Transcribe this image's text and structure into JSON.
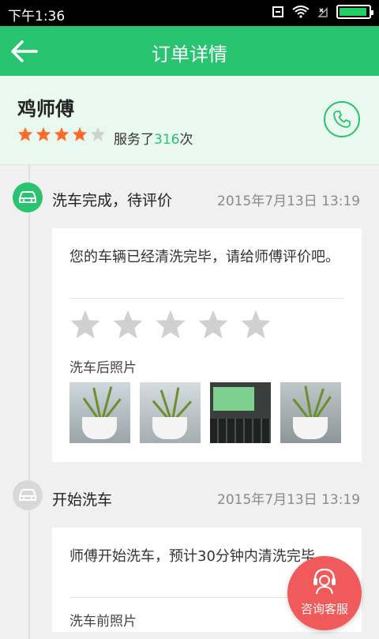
{
  "status_bar": {
    "time": "下午1:36"
  },
  "app_bar": {
    "title": "订单详情"
  },
  "worker": {
    "name": "鸡师傅",
    "rating": 4,
    "rating_max": 5,
    "service_prefix": "服务了",
    "service_count": "316",
    "service_suffix": "次"
  },
  "events": [
    {
      "title": "洗车完成，待评价",
      "time": "2015年7月13日 13:19",
      "message": "您的车辆已经清洗完毕，请给师傅评价吧。",
      "photos_label": "洗车后照片",
      "photos": [
        "plant-photo",
        "plant-photo",
        "keyboard-photo",
        "plant-photo"
      ]
    },
    {
      "title": "开始洗车",
      "time": "2015年7月13日 13:19",
      "message": "师傅开始洗车，预计30分钟内清洗完毕。",
      "photos_label": "洗车前照片"
    }
  ],
  "fab": {
    "label": "咨询客服"
  },
  "colors": {
    "primary": "#29c46f",
    "star": "#ff6a2b",
    "fab": "#f05a5a"
  }
}
